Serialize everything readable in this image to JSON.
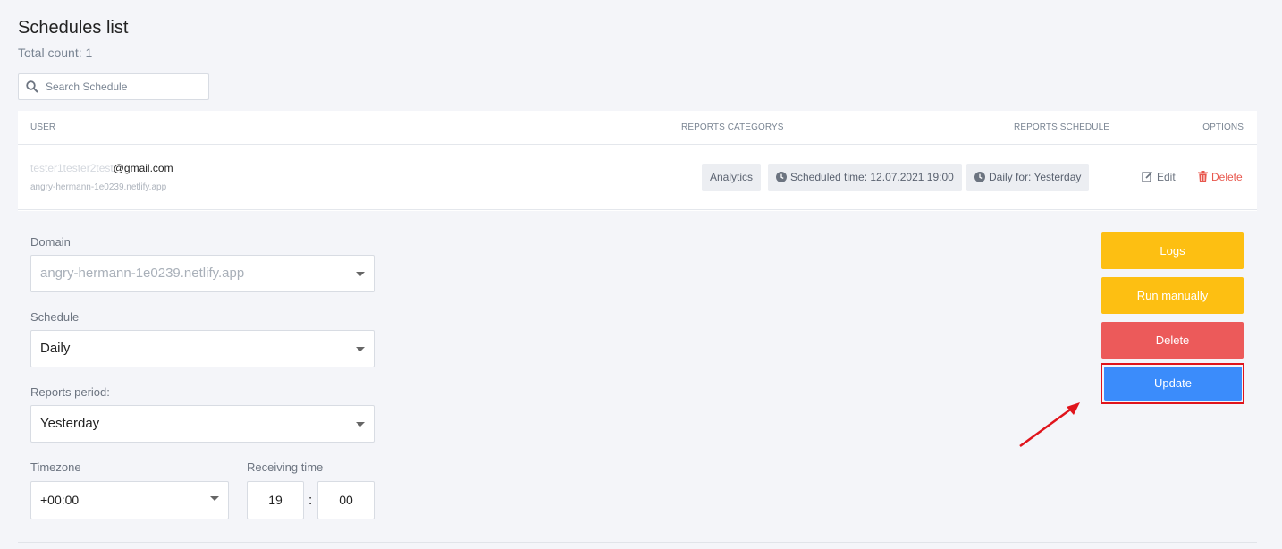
{
  "page": {
    "title": "Schedules list",
    "total_count": "Total count: 1"
  },
  "search": {
    "placeholder": "Search Schedule",
    "value": ""
  },
  "table": {
    "headers": {
      "user": "USER",
      "categories": "REPORTS CATEGORYS",
      "schedule": "REPORTS SCHEDULE",
      "options": "OPTIONS"
    },
    "row": {
      "email_blurred": "tester1tester2test",
      "email_visible": "@gmail.com",
      "domain": "angry-hermann-1e0239.netlify.app",
      "category_badge": "Analytics",
      "scheduled_time": "Scheduled time: 12.07.2021 19:00",
      "daily_for": "Daily for: Yesterday",
      "edit_label": "Edit",
      "delete_label": "Delete"
    }
  },
  "form": {
    "domain_label": "Domain",
    "domain_value": "angry-hermann-1e0239.netlify.app",
    "schedule_label": "Schedule",
    "schedule_value": "Daily",
    "period_label": "Reports period:",
    "period_value": "Yesterday",
    "timezone_label": "Timezone",
    "timezone_value": "+00:00",
    "receiving_label": "Receiving time",
    "hour": "19",
    "minute": "00",
    "separator": ":"
  },
  "actions": {
    "logs": "Logs",
    "run_manually": "Run manually",
    "delete": "Delete",
    "update": "Update"
  },
  "colors": {
    "warning": "#fdbf12",
    "danger": "#ec5a5a",
    "primary": "#3b8cfb",
    "annotation": "#e0141c"
  }
}
